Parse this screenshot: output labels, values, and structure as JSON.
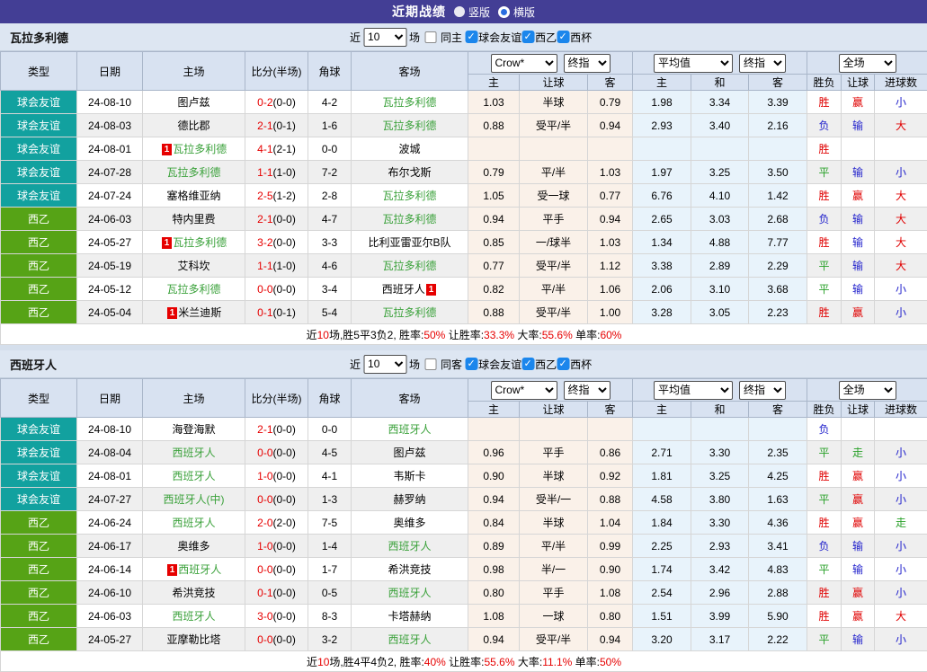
{
  "topbar": {
    "title": "近期战绩",
    "radio_vertical": "竖版",
    "radio_horizontal": "横版"
  },
  "colors": {
    "topbar_bg": "#433e95",
    "league": {
      "球会友谊": "#12a19f",
      "西乙": "#56a316"
    },
    "result": {
      "胜": "#e00000",
      "平": "#2aa12a",
      "负": "#2222cc",
      "赢": "#e00000",
      "输": "#2222cc",
      "走": "#2aa12a",
      "大": "#e00000",
      "小": "#2222cc"
    },
    "focal_team_green": "#3aa13a",
    "score_red": "#e60000",
    "crow_columns_bg": "#faf1e9",
    "avg_columns_bg": "#e8f3fb"
  },
  "header_columns": {
    "left": [
      "类型",
      "日期",
      "主场",
      "比分(半场)",
      "角球",
      "客场"
    ],
    "sub": [
      "主",
      "让球",
      "客",
      "主",
      "和",
      "客",
      "胜负",
      "让球",
      "进球数"
    ]
  },
  "sections": [
    {
      "team": "瓦拉多利德",
      "controls": {
        "near": "近",
        "games": "10",
        "games_suffix": "场",
        "same_venue": "同主",
        "filters": [
          "球会友谊",
          "西乙",
          "西杯"
        ]
      },
      "selects": {
        "bookmaker": "Crow*",
        "final1": "终指",
        "average": "平均值",
        "final2": "终指",
        "scope": "全场"
      },
      "rows": [
        {
          "league": "球会友谊",
          "date": "24-08-10",
          "home": "图卢兹",
          "home_focal": false,
          "home_badge": false,
          "score": "0-2",
          "half": "(0-0)",
          "corner": "4-2",
          "away": "瓦拉多利德",
          "away_focal": true,
          "away_badge": false,
          "odds": [
            "1.03",
            "半球",
            "0.79"
          ],
          "avg": [
            "1.98",
            "3.34",
            "3.39"
          ],
          "outcome": [
            "胜",
            "赢",
            "小"
          ]
        },
        {
          "league": "球会友谊",
          "date": "24-08-03",
          "home": "德比郡",
          "home_focal": false,
          "home_badge": false,
          "score": "2-1",
          "half": "(0-1)",
          "corner": "1-6",
          "away": "瓦拉多利德",
          "away_focal": true,
          "away_badge": false,
          "odds": [
            "0.88",
            "受平/半",
            "0.94"
          ],
          "avg": [
            "2.93",
            "3.40",
            "2.16"
          ],
          "outcome": [
            "负",
            "输",
            "大"
          ]
        },
        {
          "league": "球会友谊",
          "date": "24-08-01",
          "home": "瓦拉多利德",
          "home_focal": true,
          "home_badge": true,
          "score": "4-1",
          "half": "(2-1)",
          "corner": "0-0",
          "away": "波城",
          "away_focal": false,
          "away_badge": false,
          "odds": [
            "",
            "",
            ""
          ],
          "avg": [
            "",
            "",
            ""
          ],
          "outcome": [
            "胜",
            "",
            ""
          ]
        },
        {
          "league": "球会友谊",
          "date": "24-07-28",
          "home": "瓦拉多利德",
          "home_focal": true,
          "home_badge": false,
          "score": "1-1",
          "half": "(1-0)",
          "corner": "7-2",
          "away": "布尔戈斯",
          "away_focal": false,
          "away_badge": false,
          "odds": [
            "0.79",
            "平/半",
            "1.03"
          ],
          "avg": [
            "1.97",
            "3.25",
            "3.50"
          ],
          "outcome": [
            "平",
            "输",
            "小"
          ]
        },
        {
          "league": "球会友谊",
          "date": "24-07-24",
          "home": "塞格维亚纳",
          "home_focal": false,
          "home_badge": false,
          "score": "2-5",
          "half": "(1-2)",
          "corner": "2-8",
          "away": "瓦拉多利德",
          "away_focal": true,
          "away_badge": false,
          "odds": [
            "1.05",
            "受一球",
            "0.77"
          ],
          "avg": [
            "6.76",
            "4.10",
            "1.42"
          ],
          "outcome": [
            "胜",
            "赢",
            "大"
          ]
        },
        {
          "league": "西乙",
          "date": "24-06-03",
          "home": "特内里费",
          "home_focal": false,
          "home_badge": false,
          "score": "2-1",
          "half": "(0-0)",
          "corner": "4-7",
          "away": "瓦拉多利德",
          "away_focal": true,
          "away_badge": false,
          "odds": [
            "0.94",
            "平手",
            "0.94"
          ],
          "avg": [
            "2.65",
            "3.03",
            "2.68"
          ],
          "outcome": [
            "负",
            "输",
            "大"
          ]
        },
        {
          "league": "西乙",
          "date": "24-05-27",
          "home": "瓦拉多利德",
          "home_focal": true,
          "home_badge": true,
          "score": "3-2",
          "half": "(0-0)",
          "corner": "3-3",
          "away": "比利亚雷亚尔B队",
          "away_focal": false,
          "away_badge": false,
          "odds": [
            "0.85",
            "一/球半",
            "1.03"
          ],
          "avg": [
            "1.34",
            "4.88",
            "7.77"
          ],
          "outcome": [
            "胜",
            "输",
            "大"
          ]
        },
        {
          "league": "西乙",
          "date": "24-05-19",
          "home": "艾科坎",
          "home_focal": false,
          "home_badge": false,
          "score": "1-1",
          "half": "(1-0)",
          "corner": "4-6",
          "away": "瓦拉多利德",
          "away_focal": true,
          "away_badge": false,
          "odds": [
            "0.77",
            "受平/半",
            "1.12"
          ],
          "avg": [
            "3.38",
            "2.89",
            "2.29"
          ],
          "outcome": [
            "平",
            "输",
            "大"
          ]
        },
        {
          "league": "西乙",
          "date": "24-05-12",
          "home": "瓦拉多利德",
          "home_focal": true,
          "home_badge": false,
          "score": "0-0",
          "half": "(0-0)",
          "corner": "3-4",
          "away": "西班牙人",
          "away_focal": false,
          "away_badge": true,
          "odds": [
            "0.82",
            "平/半",
            "1.06"
          ],
          "avg": [
            "2.06",
            "3.10",
            "3.68"
          ],
          "outcome": [
            "平",
            "输",
            "小"
          ]
        },
        {
          "league": "西乙",
          "date": "24-05-04",
          "home": "米兰迪斯",
          "home_focal": false,
          "home_badge": true,
          "score": "0-1",
          "half": "(0-1)",
          "corner": "5-4",
          "away": "瓦拉多利德",
          "away_focal": true,
          "away_badge": false,
          "odds": [
            "0.88",
            "受平/半",
            "1.00"
          ],
          "avg": [
            "3.28",
            "3.05",
            "2.23"
          ],
          "outcome": [
            "胜",
            "赢",
            "小"
          ]
        }
      ],
      "summary": [
        {
          "t": "近",
          "red": false
        },
        {
          "t": "10",
          "red": true
        },
        {
          "t": "场,胜5平3负2, 胜率:",
          "red": false
        },
        {
          "t": "50%",
          "red": true
        },
        {
          "t": " 让胜率:",
          "red": false
        },
        {
          "t": "33.3%",
          "red": true
        },
        {
          "t": " 大率:",
          "red": false
        },
        {
          "t": "55.6%",
          "red": true
        },
        {
          "t": " 单率:",
          "red": false
        },
        {
          "t": "60%",
          "red": true
        }
      ]
    },
    {
      "team": "西班牙人",
      "controls": {
        "near": "近",
        "games": "10",
        "games_suffix": "场",
        "same_venue": "同客",
        "filters": [
          "球会友谊",
          "西乙",
          "西杯"
        ]
      },
      "selects": {
        "bookmaker": "Crow*",
        "final1": "终指",
        "average": "平均值",
        "final2": "终指",
        "scope": "全场"
      },
      "rows": [
        {
          "league": "球会友谊",
          "date": "24-08-10",
          "home": "海登海默",
          "home_focal": false,
          "home_badge": false,
          "score": "2-1",
          "half": "(0-0)",
          "corner": "0-0",
          "away": "西班牙人",
          "away_focal": true,
          "away_badge": false,
          "odds": [
            "",
            "",
            ""
          ],
          "avg": [
            "",
            "",
            ""
          ],
          "outcome": [
            "负",
            "",
            ""
          ]
        },
        {
          "league": "球会友谊",
          "date": "24-08-04",
          "home": "西班牙人",
          "home_focal": true,
          "home_badge": false,
          "score": "0-0",
          "half": "(0-0)",
          "corner": "4-5",
          "away": "图卢兹",
          "away_focal": false,
          "away_badge": false,
          "odds": [
            "0.96",
            "平手",
            "0.86"
          ],
          "avg": [
            "2.71",
            "3.30",
            "2.35"
          ],
          "outcome": [
            "平",
            "走",
            "小"
          ]
        },
        {
          "league": "球会友谊",
          "date": "24-08-01",
          "home": "西班牙人",
          "home_focal": true,
          "home_badge": false,
          "score": "1-0",
          "half": "(0-0)",
          "corner": "4-1",
          "away": "韦斯卡",
          "away_focal": false,
          "away_badge": false,
          "odds": [
            "0.90",
            "半球",
            "0.92"
          ],
          "avg": [
            "1.81",
            "3.25",
            "4.25"
          ],
          "outcome": [
            "胜",
            "赢",
            "小"
          ]
        },
        {
          "league": "球会友谊",
          "date": "24-07-27",
          "home": "西班牙人(中)",
          "home_focal": true,
          "home_badge": false,
          "score": "0-0",
          "half": "(0-0)",
          "corner": "1-3",
          "away": "赫罗纳",
          "away_focal": false,
          "away_badge": false,
          "odds": [
            "0.94",
            "受半/一",
            "0.88"
          ],
          "avg": [
            "4.58",
            "3.80",
            "1.63"
          ],
          "outcome": [
            "平",
            "赢",
            "小"
          ]
        },
        {
          "league": "西乙",
          "date": "24-06-24",
          "home": "西班牙人",
          "home_focal": true,
          "home_badge": false,
          "score": "2-0",
          "half": "(2-0)",
          "corner": "7-5",
          "away": "奥维多",
          "away_focal": false,
          "away_badge": false,
          "odds": [
            "0.84",
            "半球",
            "1.04"
          ],
          "avg": [
            "1.84",
            "3.30",
            "4.36"
          ],
          "outcome": [
            "胜",
            "赢",
            "走"
          ]
        },
        {
          "league": "西乙",
          "date": "24-06-17",
          "home": "奥维多",
          "home_focal": false,
          "home_badge": false,
          "score": "1-0",
          "half": "(0-0)",
          "corner": "1-4",
          "away": "西班牙人",
          "away_focal": true,
          "away_badge": false,
          "odds": [
            "0.89",
            "平/半",
            "0.99"
          ],
          "avg": [
            "2.25",
            "2.93",
            "3.41"
          ],
          "outcome": [
            "负",
            "输",
            "小"
          ]
        },
        {
          "league": "西乙",
          "date": "24-06-14",
          "home": "西班牙人",
          "home_focal": true,
          "home_badge": true,
          "score": "0-0",
          "half": "(0-0)",
          "corner": "1-7",
          "away": "希洪竞技",
          "away_focal": false,
          "away_badge": false,
          "odds": [
            "0.98",
            "半/一",
            "0.90"
          ],
          "avg": [
            "1.74",
            "3.42",
            "4.83"
          ],
          "outcome": [
            "平",
            "输",
            "小"
          ]
        },
        {
          "league": "西乙",
          "date": "24-06-10",
          "home": "希洪竞技",
          "home_focal": false,
          "home_badge": false,
          "score": "0-1",
          "half": "(0-0)",
          "corner": "0-5",
          "away": "西班牙人",
          "away_focal": true,
          "away_badge": false,
          "odds": [
            "0.80",
            "平手",
            "1.08"
          ],
          "avg": [
            "2.54",
            "2.96",
            "2.88"
          ],
          "outcome": [
            "胜",
            "赢",
            "小"
          ]
        },
        {
          "league": "西乙",
          "date": "24-06-03",
          "home": "西班牙人",
          "home_focal": true,
          "home_badge": false,
          "score": "3-0",
          "half": "(0-0)",
          "corner": "8-3",
          "away": "卡塔赫纳",
          "away_focal": false,
          "away_badge": false,
          "odds": [
            "1.08",
            "一球",
            "0.80"
          ],
          "avg": [
            "1.51",
            "3.99",
            "5.90"
          ],
          "outcome": [
            "胜",
            "赢",
            "大"
          ]
        },
        {
          "league": "西乙",
          "date": "24-05-27",
          "home": "亚摩勒比塔",
          "home_focal": false,
          "home_badge": false,
          "score": "0-0",
          "half": "(0-0)",
          "corner": "3-2",
          "away": "西班牙人",
          "away_focal": true,
          "away_badge": false,
          "odds": [
            "0.94",
            "受平/半",
            "0.94"
          ],
          "avg": [
            "3.20",
            "3.17",
            "2.22"
          ],
          "outcome": [
            "平",
            "输",
            "小"
          ]
        }
      ],
      "summary": [
        {
          "t": "近",
          "red": false
        },
        {
          "t": "10",
          "red": true
        },
        {
          "t": "场,胜4平4负2, 胜率:",
          "red": false
        },
        {
          "t": "40%",
          "red": true
        },
        {
          "t": " 让胜率:",
          "red": false
        },
        {
          "t": "55.6%",
          "red": true
        },
        {
          "t": " 大率:",
          "red": false
        },
        {
          "t": "11.1%",
          "red": true
        },
        {
          "t": " 单率:",
          "red": false
        },
        {
          "t": "50%",
          "red": true
        }
      ]
    }
  ]
}
